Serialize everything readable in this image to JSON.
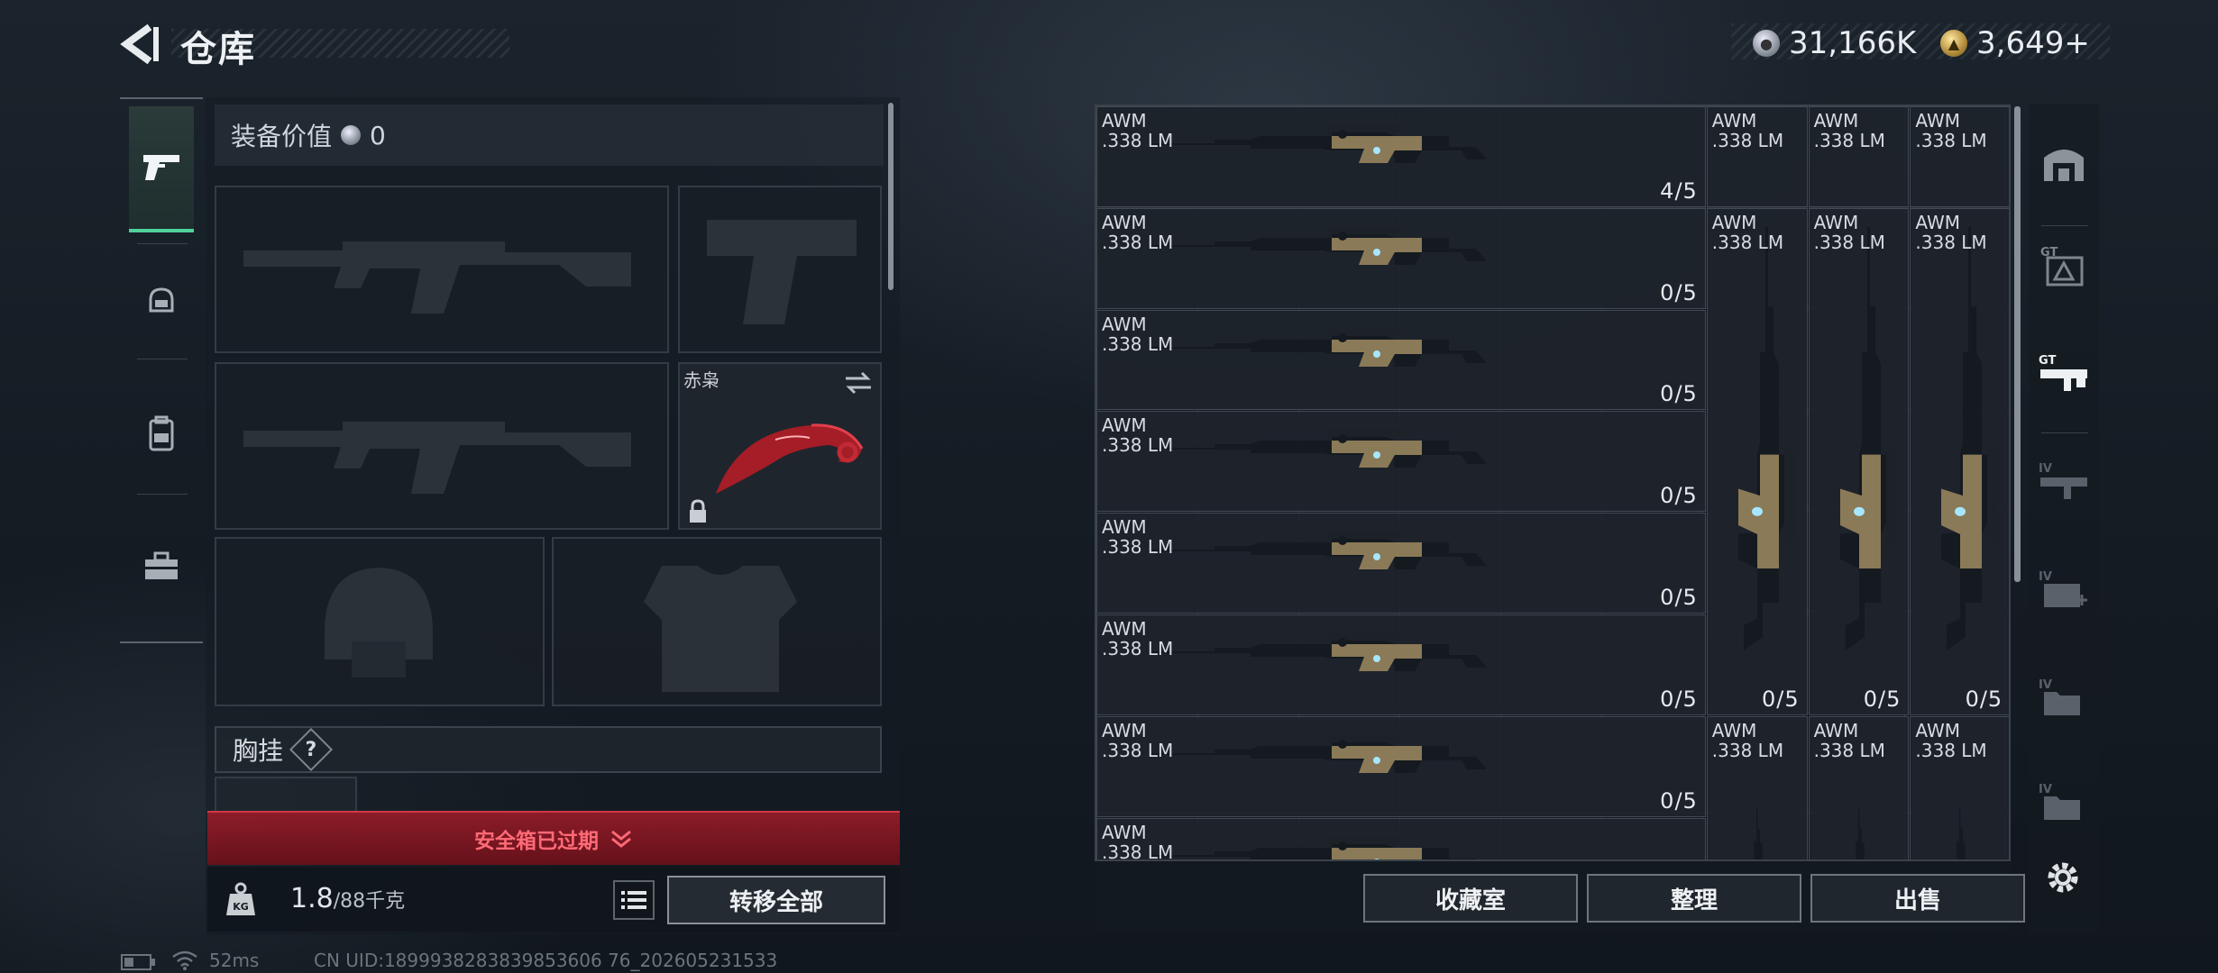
{
  "header": {
    "title": "仓库"
  },
  "currency": {
    "silver": "31,166K",
    "gold": "3,649+"
  },
  "equipment": {
    "value_label": "装备价值",
    "value": "0",
    "knife_name": "赤枭",
    "chest_label": "胸挂",
    "help": "?"
  },
  "warning": {
    "text": "安全箱已过期"
  },
  "capacity": {
    "current": "1.8",
    "max": "/88千克"
  },
  "buttons": {
    "transfer_all": "转移全部",
    "collection": "收藏室",
    "organize": "整理",
    "sell": "出售"
  },
  "storage": {
    "items": [
      {
        "name": "AWM\n.338 LM",
        "count": "4/5"
      },
      {
        "name": "AWM\n.338 LM",
        "count": ""
      },
      {
        "name": "AWM\n.338 LM",
        "count": ""
      },
      {
        "name": "AWM\n.338 LM",
        "count": ""
      },
      {
        "name": "AWM\n.338 LM",
        "count": "0/5"
      },
      {
        "name": "AWM\n.338 LM",
        "count": "0/5"
      },
      {
        "name": "AWM\n.338 LM",
        "count": "0/5"
      },
      {
        "name": "AWM\n.338 LM",
        "count": "0/5"
      },
      {
        "name": "AWM\n.338 LM",
        "count": "0/5"
      },
      {
        "name": "AWM\n.338 LM",
        "count": "0/5"
      },
      {
        "name": "AWM\n.338 LM",
        "count": "0/5"
      },
      {
        "name": "AWM\n.338 LM",
        "count": "0/5"
      },
      {
        "name": "AWM\n.338 LM",
        "count": "0/5"
      },
      {
        "name": "AWM\n.338 LM",
        "count": "0/5"
      },
      {
        "name": "AWM\n.338 LM",
        "count": "0/5"
      },
      {
        "name": "AWM\n.338 LM",
        "count": "0/5"
      },
      {
        "name": "AWM\n.338 LM",
        "count": "0/5"
      },
      {
        "name": "AWM\n.338 LM",
        "count": ""
      }
    ]
  },
  "status": {
    "ping": "52ms",
    "uid": "CN UID:1899938283839853606 76_202605231533"
  },
  "colors": {
    "accent_green": "#4fd19a",
    "warning_red": "#d23846"
  }
}
